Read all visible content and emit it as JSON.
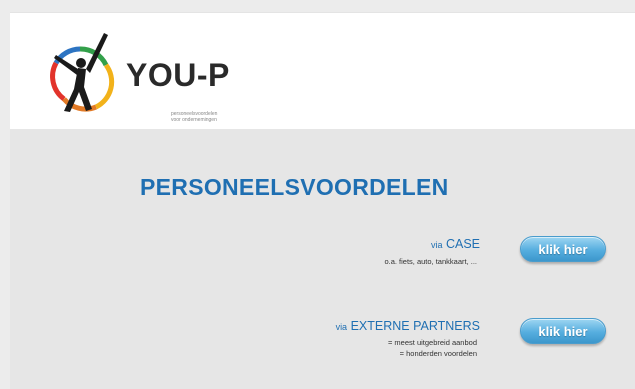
{
  "header": {
    "brand": "YOU-P",
    "tagline_line1": "personeelsvoordelen",
    "tagline_line2": "voor ondernemingen"
  },
  "main": {
    "title": "PERSONEELSVOORDELEN",
    "offers": [
      {
        "via": "via",
        "name": "CASE",
        "details": [
          "o.a. fiets, auto, tankkaart, ..."
        ],
        "button_label": "klik hier"
      },
      {
        "via": "via",
        "name": "EXTERNE PARTNERS",
        "details": [
          "= meest uitgebreid aanbod",
          "= honderden voordelen"
        ],
        "button_label": "klik hier"
      }
    ]
  },
  "colors": {
    "accent_blue": "#1f6fb2",
    "button_blue": "#56aedf",
    "background": "#e6e6e6"
  }
}
